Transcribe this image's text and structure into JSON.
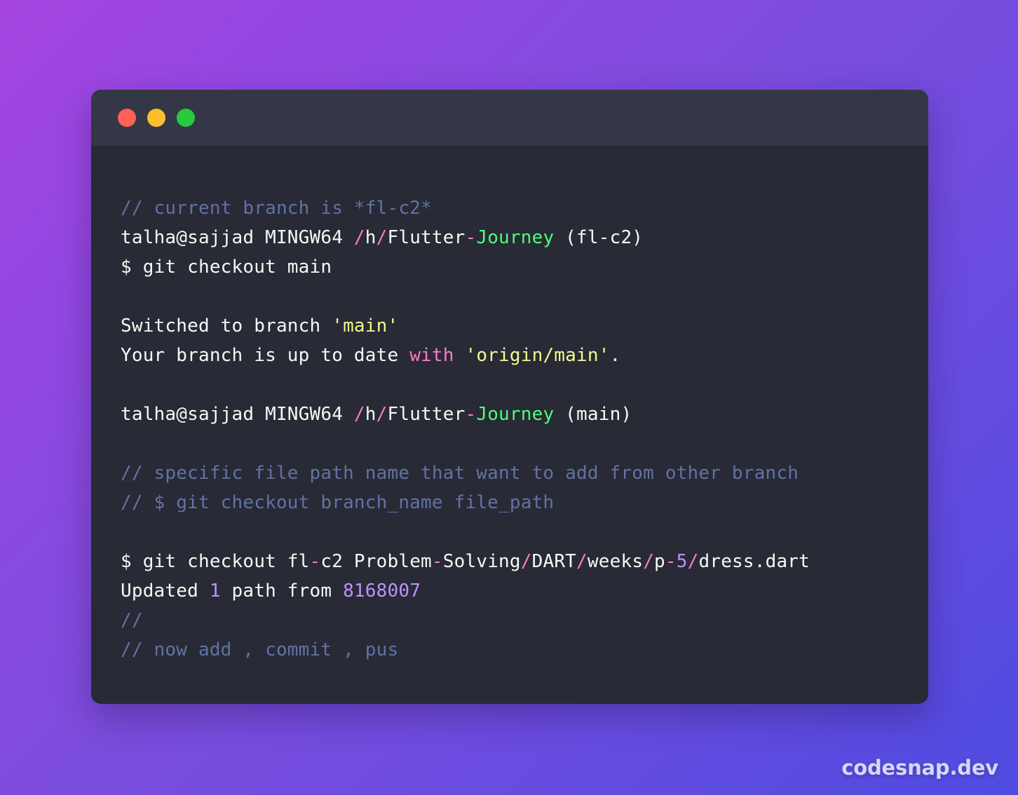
{
  "window": {
    "traffic_lights": [
      {
        "name": "close-button",
        "color": "#ff5f56"
      },
      {
        "name": "minimize-button",
        "color": "#ffbd2e"
      },
      {
        "name": "maximize-button",
        "color": "#27c93f"
      }
    ]
  },
  "theme": {
    "background_gradient_from": "#a545e0",
    "background_gradient_to": "#4f4be0",
    "titlebar_bg": "#343746",
    "terminal_bg": "#282a36",
    "foreground": "#f8f8f2",
    "comment": "#6272a4",
    "pink": "#ff79c6",
    "green": "#50fa7b",
    "yellow": "#f1fa8c",
    "purple": "#bd93f9"
  },
  "terminal": {
    "lines": [
      {
        "id": "line-comment-current-branch",
        "tokens": [
          {
            "t": "// current branch is *fl-c2*",
            "c": "comment"
          }
        ]
      },
      {
        "id": "line-prompt-flc2",
        "tokens": [
          {
            "t": "talha@sajjad MINGW64 ",
            "c": "text"
          },
          {
            "t": "/",
            "c": "pink"
          },
          {
            "t": "h",
            "c": "text"
          },
          {
            "t": "/",
            "c": "pink"
          },
          {
            "t": "Flutter",
            "c": "text"
          },
          {
            "t": "-",
            "c": "pink"
          },
          {
            "t": "Journey",
            "c": "green"
          },
          {
            "t": " (fl-c2)",
            "c": "text"
          }
        ]
      },
      {
        "id": "line-cmd-checkout-main",
        "tokens": [
          {
            "t": "$ git checkout main",
            "c": "text"
          }
        ]
      },
      {
        "id": "line-blank-1",
        "blank": true,
        "tokens": []
      },
      {
        "id": "line-switched-to-branch",
        "tokens": [
          {
            "t": "Switched to branch ",
            "c": "text"
          },
          {
            "t": "'main'",
            "c": "yellow"
          }
        ]
      },
      {
        "id": "line-up-to-date",
        "tokens": [
          {
            "t": "Your branch is up to date ",
            "c": "text"
          },
          {
            "t": "with",
            "c": "pink"
          },
          {
            "t": " ",
            "c": "text"
          },
          {
            "t": "'origin/main'",
            "c": "yellow"
          },
          {
            "t": ".",
            "c": "text"
          }
        ]
      },
      {
        "id": "line-blank-2",
        "blank": true,
        "tokens": []
      },
      {
        "id": "line-prompt-main",
        "tokens": [
          {
            "t": "talha@sajjad MINGW64 ",
            "c": "text"
          },
          {
            "t": "/",
            "c": "pink"
          },
          {
            "t": "h",
            "c": "text"
          },
          {
            "t": "/",
            "c": "pink"
          },
          {
            "t": "Flutter",
            "c": "text"
          },
          {
            "t": "-",
            "c": "pink"
          },
          {
            "t": "Journey",
            "c": "green"
          },
          {
            "t": " (main)",
            "c": "text"
          }
        ]
      },
      {
        "id": "line-blank-3",
        "blank": true,
        "tokens": []
      },
      {
        "id": "line-comment-specific-file-path",
        "tokens": [
          {
            "t": "// specific file path name that want to add from other branch",
            "c": "comment"
          }
        ]
      },
      {
        "id": "line-comment-checkout-usage",
        "tokens": [
          {
            "t": "// $ git checkout branch_name file_path",
            "c": "comment"
          }
        ]
      },
      {
        "id": "line-blank-4",
        "blank": true,
        "tokens": []
      },
      {
        "id": "line-cmd-checkout-file",
        "tokens": [
          {
            "t": "$ git checkout fl",
            "c": "text"
          },
          {
            "t": "-",
            "c": "pink"
          },
          {
            "t": "c2 Problem",
            "c": "text"
          },
          {
            "t": "-",
            "c": "pink"
          },
          {
            "t": "Solving",
            "c": "text"
          },
          {
            "t": "/",
            "c": "pink"
          },
          {
            "t": "DART",
            "c": "text"
          },
          {
            "t": "/",
            "c": "pink"
          },
          {
            "t": "weeks",
            "c": "text"
          },
          {
            "t": "/",
            "c": "pink"
          },
          {
            "t": "p",
            "c": "text"
          },
          {
            "t": "-",
            "c": "pink"
          },
          {
            "t": "5",
            "c": "purple"
          },
          {
            "t": "/",
            "c": "pink"
          },
          {
            "t": "dress.dart",
            "c": "text"
          }
        ]
      },
      {
        "id": "line-updated-path",
        "tokens": [
          {
            "t": "Updated ",
            "c": "text"
          },
          {
            "t": "1",
            "c": "purple"
          },
          {
            "t": " path from ",
            "c": "text"
          },
          {
            "t": "8168007",
            "c": "purple"
          }
        ]
      },
      {
        "id": "line-comment-empty",
        "tokens": [
          {
            "t": "//",
            "c": "comment"
          }
        ]
      },
      {
        "id": "line-comment-now-add",
        "tokens": [
          {
            "t": "// now add , commit , pus",
            "c": "comment"
          }
        ]
      }
    ]
  },
  "watermark": {
    "label": "codesnap.dev"
  }
}
